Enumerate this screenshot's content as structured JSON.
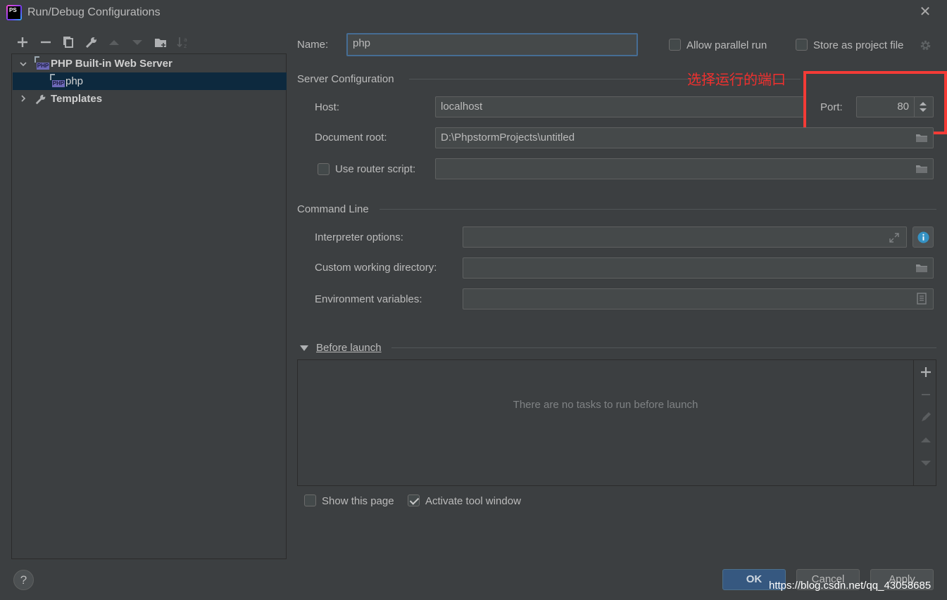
{
  "window": {
    "title": "Run/Debug Configurations",
    "app_icon_text": "PS"
  },
  "toolbar": {
    "add_icon": "+",
    "remove_icon": "−",
    "copy_icon": "copy",
    "edit_defaults_icon": "wrench",
    "move_up_icon": "arrow-up",
    "move_down_icon": "arrow-down",
    "new_folder_icon": "folder-add",
    "sort_icon": "sort-alpha"
  },
  "tree": {
    "items": [
      {
        "label": "PHP Built-in Web Server",
        "expanded": true
      },
      {
        "label": "php",
        "selected": true
      },
      {
        "label": "Templates",
        "expanded": false
      }
    ]
  },
  "form": {
    "name_label": "Name:",
    "name_value": "php",
    "allow_parallel_label": "Allow parallel run",
    "store_project_label": "Store as project file",
    "server_section": "Server Configuration",
    "host_label": "Host:",
    "host_value": "localhost",
    "port_label": "Port:",
    "port_value": "80",
    "docroot_label": "Document root:",
    "docroot_value": "D:\\PhpstormProjects\\untitled",
    "router_label": "Use router script:",
    "router_value": "",
    "command_section": "Command Line",
    "interp_label": "Interpreter options:",
    "interp_value": "",
    "cwd_label": "Custom working directory:",
    "cwd_value": "",
    "env_label": "Environment variables:",
    "env_value": "",
    "before_launch_label": "Before launch",
    "before_launch_empty": "There are no tasks to run before launch",
    "show_page_label": "Show this page",
    "activate_tool_label": "Activate tool window"
  },
  "annotation": {
    "text": "选择运行的端口",
    "color": "#f43b36"
  },
  "buttons": {
    "ok": "OK",
    "cancel": "Cancel",
    "apply": "Apply",
    "help": "?"
  },
  "watermark": "https://blog.csdn.net/qq_43058685",
  "colors": {
    "background": "#3c3f41",
    "selection": "#0d293e",
    "ok_button": "#365880",
    "focus_border": "#466d94"
  }
}
